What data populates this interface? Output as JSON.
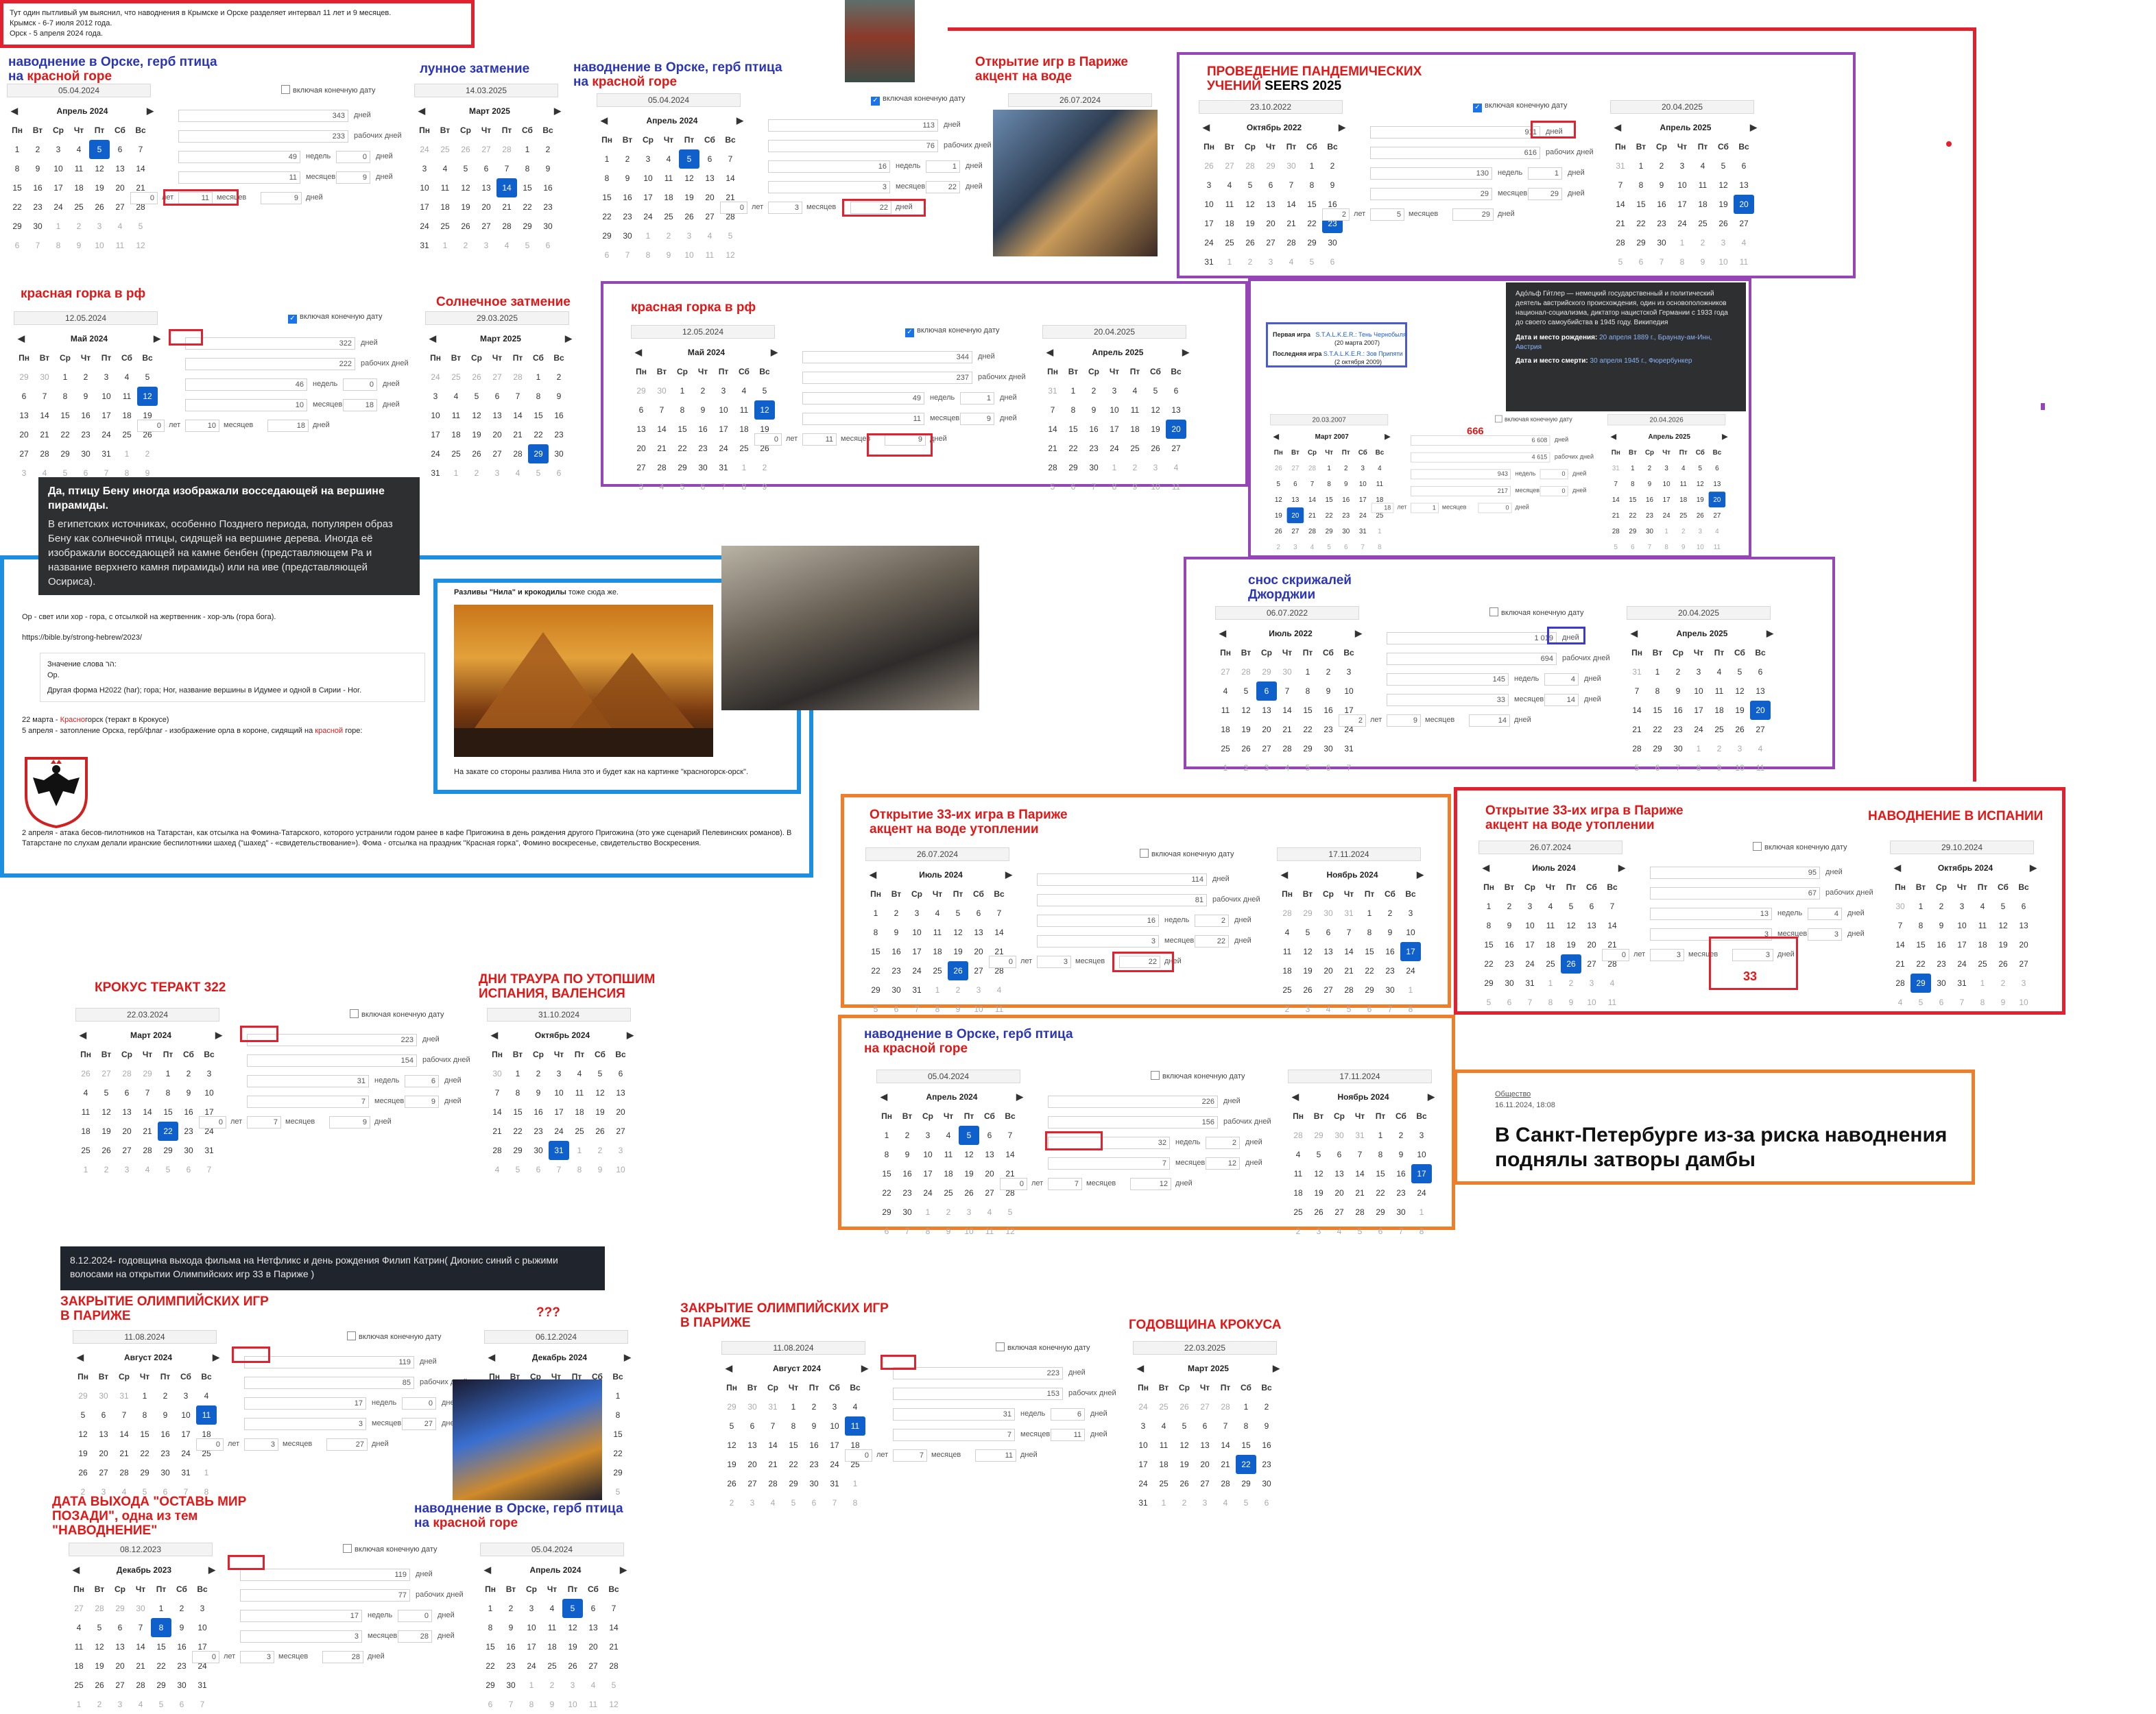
{
  "top_note": {
    "line1": "Тут один пытливый ум выяснил, что наводнения в Крымске и Орске разделяет интервал 11 лет и 9 месяцев.",
    "line2": "Крымск - 6-7 июля 2012 года.",
    "line3": "Орск - 5 апреля 2024 года."
  },
  "captions": {
    "orsk1_a": "наводнение в Орске, герб птица",
    "orsk1_b_pre": "на ",
    "orsk1_b_red": "красной горе",
    "lunar": "лунное затмение",
    "orsk2_a": "наводнение в Орске, герб птица",
    "orsk2_b_pre": "на ",
    "orsk2_b_red": "красной горе",
    "paris_open": "Открытие игр в Париже\nакцент на воде",
    "pandemic_a": "ПРОВЕДЕНИЕ ПАНДЕМИЧЕСКИХ",
    "pandemic_b_red": "УЧЕНИЙ ",
    "pandemic_b_black": "SEERS 2025",
    "krasnaya_gorka1": "красная горка в рф",
    "solar": "Солнечное затмение",
    "krasnaya_gorka2": "красная горка в рф",
    "georgia": "снос скрижалей\nДжорджии",
    "paris33_a": "Открытие 33-их игра в Париже\nакцент на воде утоплении",
    "paris33_b": "Открытие 33-их игра в Париже\nакцент на воде утоплении",
    "spain_flood": "НАВОДНЕНИЕ В ИСПАНИИ",
    "crocus": "КРОКУС ТЕРАКТ 322",
    "mourning": "ДНИ ТРАУРА ПО УТОПШИМ\nИСПАНИЯ, ВАЛЕНСИЯ",
    "orsk3_a": "наводнение в Орске, герб птица",
    "orsk3_b_red": "на красной горе",
    "olymp_close1": "ЗАКРЫТИЕ ОЛИМПИЙСКИХ ИГР\nВ ПАРИЖЕ",
    "qqq": "???",
    "olymp_close2": "ЗАКРЫТИЕ ОЛИМПИЙСКИХ ИГР\nВ ПАРИЖЕ",
    "crocus_anniv": "ГОДОВЩИНА КРОКУСА",
    "leave_world": "ДАТА ВЫХОДА \"ОСТАВЬ МИР\nПОЗАДИ\", одна из тем\n\"НАВОДНЕНИЕ\"",
    "orsk4_a": "наводнение в Орске, герб птица",
    "orsk4_b_pre": "на ",
    "orsk4_b_red": "красной горе",
    "num33": "33"
  },
  "calc_labels": {
    "include_end": "включая конечную дату",
    "days": "дня",
    "days2": "дней",
    "workdays": "рабочих дней",
    "weeks": "недель",
    "weeks2": "недели",
    "weeks3": "неделя",
    "months": "месяцев",
    "months2": "месяца",
    "years": "лет",
    "years2": "года",
    "day1": "день"
  },
  "weekdays": [
    "Пн",
    "Вт",
    "Ср",
    "Чт",
    "Пт",
    "Сб",
    "Вс"
  ],
  "calculators": {
    "c1": {
      "start": "05.04.2024",
      "start_month": "Апрель 2024",
      "end": "",
      "end_month": "",
      "checked": false,
      "total": "343",
      "work": "233",
      "weeks": "49",
      "weeks_d": "0",
      "months": "11",
      "months_d": "9",
      "y": "0",
      "ym": "11",
      "yd": "9"
    },
    "c2": {
      "start": "14.03.2025",
      "start_month": "Март 2025"
    },
    "c3": {
      "start": "05.04.2024",
      "start_month": "Апрель 2024",
      "end": "26.07.2024",
      "end_month": "",
      "checked": true,
      "total": "113",
      "work": "76",
      "weeks": "16",
      "weeks_d": "1",
      "months": "3",
      "months_d": "22",
      "y": "0",
      "ym": "3",
      "yd": "22"
    },
    "c4": {
      "start": "23.10.2022",
      "start_month": "Октябрь 2022",
      "end": "20.04.2025",
      "end_month": "Апрель 2025",
      "checked": true,
      "total": "911",
      "work": "616",
      "weeks": "130",
      "weeks_d": "1",
      "months": "29",
      "months_d": "29",
      "y": "2",
      "ym": "5",
      "yd": "29"
    },
    "c5": {
      "start": "12.05.2024",
      "start_month": "Май 2024",
      "end": "29.03.2025",
      "end_month": "Март 2025",
      "checked": true,
      "total": "322",
      "work": "222",
      "weeks": "46",
      "weeks_d": "0",
      "months": "10",
      "months_d": "18",
      "y": "0",
      "ym": "10",
      "yd": "18"
    },
    "c6": {
      "start": "12.05.2024",
      "start_month": "Май 2024",
      "end": "20.04.2025",
      "end_month": "Апрель 2025",
      "checked": true,
      "total": "344",
      "work": "237",
      "weeks": "49",
      "weeks_d": "1",
      "months": "11",
      "months_d": "9",
      "y": "0",
      "ym": "11",
      "yd": "9"
    },
    "c7": {
      "start": "20.03.2007",
      "start_month": "Март 2007",
      "end": "20.04.2026",
      "end_month": "Апрель 2025",
      "checked": false,
      "total": "6 608",
      "work": "4 615",
      "weeks": "943",
      "weeks_d": "0",
      "months": "217",
      "months_d": "0",
      "y": "18",
      "ym": "1",
      "yd": "0",
      "big": "666"
    },
    "c8": {
      "start": "06.07.2022",
      "start_month": "Июль 2022",
      "end": "20.04.2025",
      "end_month": "Апрель 2025",
      "checked": false,
      "total": "1 019",
      "work": "694",
      "weeks": "145",
      "weeks_d": "4",
      "months": "33",
      "months_d": "14",
      "y": "2",
      "ym": "9",
      "yd": "14"
    },
    "c9": {
      "start": "26.07.2024",
      "start_month": "Июль 2024",
      "end": "17.11.2024",
      "end_month": "Ноябрь 2024",
      "checked": false,
      "total": "114",
      "work": "81",
      "weeks": "16",
      "weeks_d": "2",
      "months": "3",
      "months_d": "22",
      "y": "0",
      "ym": "3",
      "yd": "22"
    },
    "c10": {
      "start": "26.07.2024",
      "start_month": "Июль 2024",
      "end": "29.10.2024",
      "end_month": "Октябрь 2024",
      "checked": false,
      "total": "95",
      "work": "67",
      "weeks": "13",
      "weeks_d": "4",
      "months": "3",
      "months_d": "3",
      "y": "0",
      "ym": "3",
      "yd": "3"
    },
    "c11": {
      "start": "22.03.2024",
      "start_month": "Март 2024",
      "end": "31.10.2024",
      "end_month": "Октябрь 2024",
      "checked": false,
      "total": "223",
      "work": "154",
      "weeks": "31",
      "weeks_d": "6",
      "months": "7",
      "months_d": "9",
      "y": "0",
      "ym": "7",
      "yd": "9"
    },
    "c12": {
      "start": "05.04.2024",
      "start_month": "Апрель 2024",
      "end": "17.11.2024",
      "end_month": "Ноябрь 2024",
      "checked": false,
      "total": "226",
      "work": "156",
      "weeks": "32",
      "weeks_d": "2",
      "months": "7",
      "months_d": "12",
      "y": "0",
      "ym": "7",
      "yd": "12"
    },
    "c13": {
      "start": "11.08.2024",
      "start_month": "Август 2024",
      "end": "06.12.2024",
      "end_month": "Декабрь 2024",
      "checked": false,
      "total": "119",
      "work": "85",
      "weeks": "17",
      "weeks_d": "0",
      "months": "3",
      "months_d": "27",
      "y": "0",
      "ym": "3",
      "yd": "27"
    },
    "c14": {
      "start": "11.08.2024",
      "start_month": "Август 2024",
      "end": "22.03.2025",
      "end_month": "Март 2025",
      "checked": false,
      "total": "223",
      "work": "153",
      "weeks": "31",
      "weeks_d": "6",
      "months": "7",
      "months_d": "11",
      "y": "0",
      "ym": "7",
      "yd": "11"
    },
    "c15": {
      "start": "08.12.2023",
      "start_month": "Декабрь 2023",
      "end": "05.04.2024",
      "end_month": "Апрель 2024",
      "checked": false,
      "total": "119",
      "work": "77",
      "weeks": "17",
      "weeks_d": "0",
      "months": "3",
      "months_d": "28",
      "y": "0",
      "ym": "3",
      "yd": "28"
    }
  },
  "stalker": {
    "first_label": "Первая игра",
    "first_title": "S.T.A.L.K.E.R.: Тень Чернобыля",
    "first_date": "(20 марта 2007)",
    "last_label": "Последняя игра",
    "last_title": "S.T.A.L.K.E.R.: Зов Припяти",
    "last_date": "(2 октября 2009)"
  },
  "hitler_card": {
    "text": "Адо́льф Ги́тлер — немецкий государственный и политический деятель австрийского происхождения, один из основоположников национал-социализма, диктатор нацистской Германии с 1933 года до своего самоубийства в 1945 году. Википедия",
    "birth_label": "Дата и место рождения:",
    "birth_value": "20 апреля 1889 г., Браунау-ам-Инн, Австрия",
    "death_label": "Дата и место смерти:",
    "death_value": "30 апреля 1945 г., Фюрербункер"
  },
  "bennu_card": {
    "title": "Да, птицу Бену иногда изображали восседающей на вершине пирамиды.",
    "body": "В египетских источниках, особенно Позднего периода, популярен образ Бену как солнечной птицы, сидящей на вершине дерева. Иногда её изображали восседающей на камне бенбен (представляющем Ра и название верхнего камня пирамиды) или на иве (представляющей Осириса)."
  },
  "blue_panel": {
    "line1": "Ор - свет или хор - гора, с отсылкой на жертвенник - хор-эль (гора бога).",
    "link": "https://bible.by/strong-hebrew/2023/",
    "box_l1": "Значение слова הר:",
    "box_l2": "Ор.",
    "box_l3": "Другая форма H2022 (har); гора; Hor, название вершины в Идумее и одной в Сирии - Hor.",
    "march22_pre": "22 марта - ",
    "march22_red": "Красно",
    "march22_post": "горск (теракт в Крокусе)",
    "april5_pre": "5 апреля - затопление Орска, герб/флаг - изображение орла в короне, сидящий на ",
    "april5_red": "красной",
    "april5_post": " горе:",
    "bottom": "2 апреля - атака бесов-пилотников на Татарстан, как отсылка на Фомина-Татарского, которого устранили годом ранее в кафе Пригожина в день рождения другого Пригожина (это уже сценарий Пелевинских романов). В Татарстане по слухам делали иранские беспилотники шахед (\"шахед\" - «свидетельствование»). Фома - отсылка на праздник \"Красная горка\", Фомино воскресенье, свидетельство Воскресения."
  },
  "nile_panel": {
    "title_bold": "Разливы \"Нила\" и крокодилы",
    "title_rest": " тоже сюда же.",
    "footer": "На закате со стороны разлива Нила это и будет как на картинке \"красногорск-орск\"."
  },
  "news": {
    "category": "Общество",
    "date": "16.11.2024, 18:08",
    "headline": "В Санкт-Петербурге из-за риска наводнения поднялы затворы дамбы"
  },
  "netflix_note": "8.12.2024- годовщина выхода фильма на Нетфликс и день рождения Филип Катрин( Дионис синий с рыжими волосами на открытии Олимпийских игр 33 в Париже )",
  "colors": {
    "red": "#e3202e",
    "purple": "#9545b5",
    "blue": "#1c8fe0",
    "orange": "#f07d2a",
    "select": "#1060cc",
    "caption_blue": "#2a35b8"
  }
}
